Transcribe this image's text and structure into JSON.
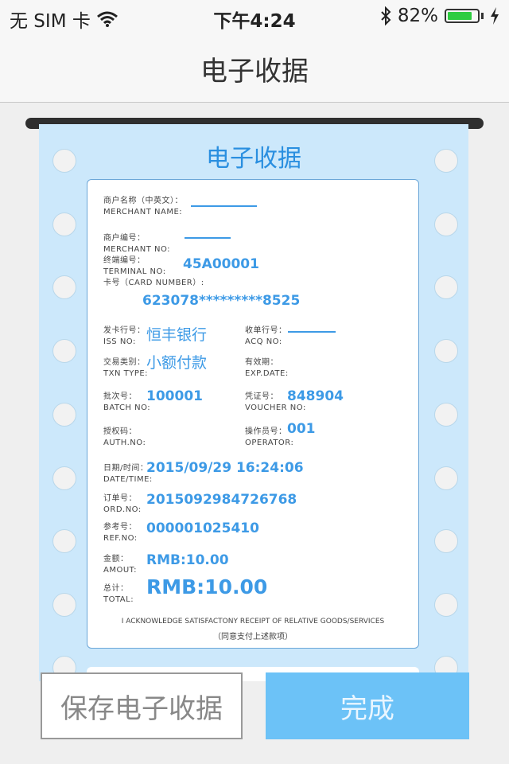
{
  "status_bar": {
    "carrier": "无 SIM 卡",
    "time": "下午4:24",
    "battery_percent": "82%",
    "battery_level": 0.82
  },
  "nav": {
    "title": "电子收据"
  },
  "receipt": {
    "title": "电子收据",
    "merchant_name": {
      "label_cn": "商户名称（中英文）：",
      "label_en": "MERCHANT NAME:"
    },
    "merchant_no": {
      "label_cn": "商户编号：",
      "label_en": "MERCHANT NO:"
    },
    "terminal_no": {
      "label_cn": "终端编号：",
      "label_en": "TERMINAL NO:",
      "value": "45A00001"
    },
    "card_number": {
      "label": "卡号（CARD NUMBER）:",
      "value": "623078*********8525"
    },
    "iss_no": {
      "label_cn": "发卡行号：",
      "label_en": "ISS NO:",
      "value": "恒丰银行"
    },
    "acq_no": {
      "label_cn": "收单行号：",
      "label_en": "ACQ NO:"
    },
    "txn_type": {
      "label_cn": "交易类别：",
      "label_en": "TXN TYPE:",
      "value": "小额付款"
    },
    "exp_date": {
      "label_cn": "有效期：",
      "label_en": "EXP.DATE:"
    },
    "batch_no": {
      "label_cn": "批次号：",
      "label_en": "BATCH NO:",
      "value": "100001"
    },
    "voucher_no": {
      "label_cn": "凭证号：",
      "label_en": "VOUCHER NO:",
      "value": "848904"
    },
    "auth_no": {
      "label_cn": "授权码：",
      "label_en": "AUTH.NO:"
    },
    "operator": {
      "label_cn": "操作员号：",
      "label_en": "OPERATOR:",
      "value": "001"
    },
    "date_time": {
      "label_cn": "日期/时间：",
      "label_en": "DATE/TIME:",
      "value": "2015/09/29 16:24:06"
    },
    "ord_no": {
      "label_cn": "订单号：",
      "label_en": "ORD.NO:",
      "value": "2015092984726768"
    },
    "ref_no": {
      "label_cn": "参考号：",
      "label_en": "REF.NO:",
      "value": "000001025410"
    },
    "amount": {
      "label_cn": "金额：",
      "label_en": "AMOUT:",
      "value": "RMB:10.00"
    },
    "total": {
      "label_cn": "总计：",
      "label_en": "TOTAL:",
      "value": "RMB:10.00"
    },
    "ack_en": "I ACKNOWLEDGE SATISFACTONY RECEIPT OF RELATIVE GOODS/SERVICES",
    "ack_cn": "（同意支付上述款项）"
  },
  "buttons": {
    "save": "保存电子收据",
    "done": "完成"
  }
}
